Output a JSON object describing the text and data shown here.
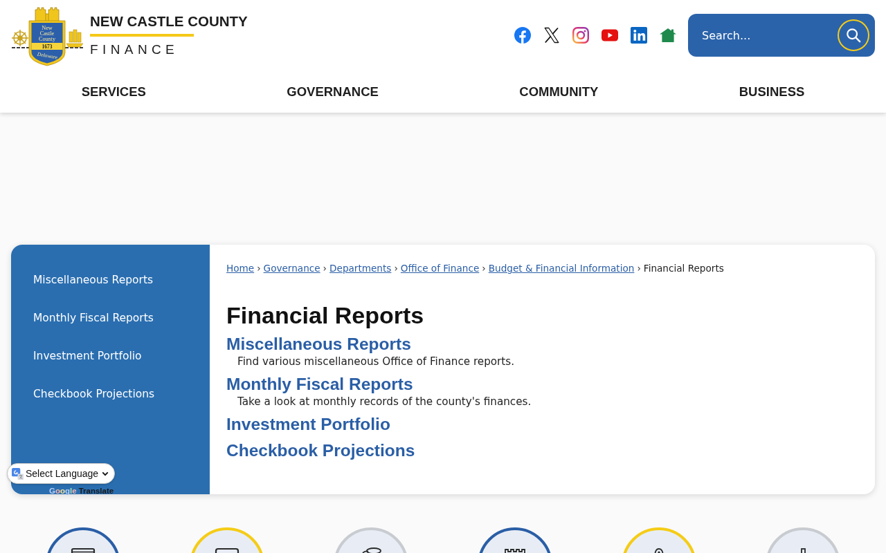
{
  "header": {
    "seal": {
      "lines": [
        "New",
        "Castle",
        "County"
      ],
      "year": "1673",
      "banner": "Delaware"
    },
    "title": "NEW CASTLE COUNTY",
    "subtitle": "FINANCE"
  },
  "search": {
    "placeholder": "Search..."
  },
  "nav": {
    "items": [
      "SERVICES",
      "GOVERNANCE",
      "COMMUNITY",
      "BUSINESS"
    ]
  },
  "sidebar": {
    "items": [
      "Miscellaneous Reports",
      "Monthly Fiscal Reports",
      "Investment Portfolio",
      "Checkbook Projections"
    ]
  },
  "breadcrumb": {
    "links": [
      "Home",
      "Governance",
      "Departments",
      "Office of Finance",
      "Budget & Financial Information"
    ],
    "separator": "›",
    "current": "Financial Reports"
  },
  "page": {
    "title": "Financial Reports",
    "sections": [
      {
        "title": "Miscellaneous Reports",
        "description": "Find various miscellaneous Office of Finance reports."
      },
      {
        "title": "Monthly Fiscal Reports",
        "description": "Take a look at monthly records of the county's finances."
      },
      {
        "title": "Investment Portfolio"
      },
      {
        "title": "Checkbook Projections"
      }
    ]
  },
  "translate": {
    "select": "Select Language",
    "brand": "Google",
    "label": "Translate"
  },
  "quick_links": [
    {
      "color": "#2a5ea6"
    },
    {
      "color": "#f5cc17"
    },
    {
      "color": "#c8ccd1"
    },
    {
      "color": "#2a5ea6"
    },
    {
      "color": "#f5cc17"
    },
    {
      "color": "#c8ccd1"
    }
  ]
}
